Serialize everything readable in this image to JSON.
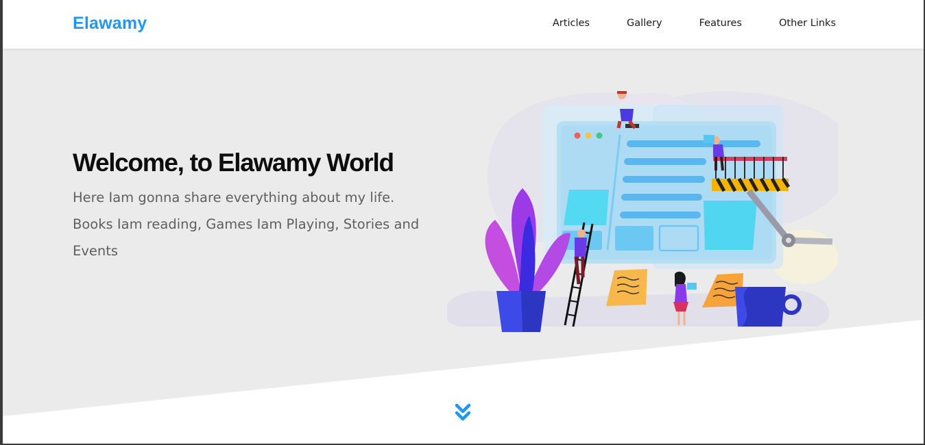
{
  "header": {
    "logo": "Elawamy",
    "nav": [
      {
        "label": "Articles"
      },
      {
        "label": "Gallery"
      },
      {
        "label": "Features"
      },
      {
        "label": "Other Links"
      }
    ]
  },
  "hero": {
    "title": "Welcome, to Elawamy World",
    "subtitle": "Here Iam gonna share everything about my life. Books Iam reading, Games Iam Playing, Stories and Events"
  },
  "colors": {
    "accent": "#2196f3",
    "hero_bg": "#ebebeb",
    "title": "#0d0d0d",
    "subtitle": "#5f5f5f"
  },
  "icons": {
    "scroll": "double-chevron-down-icon"
  }
}
